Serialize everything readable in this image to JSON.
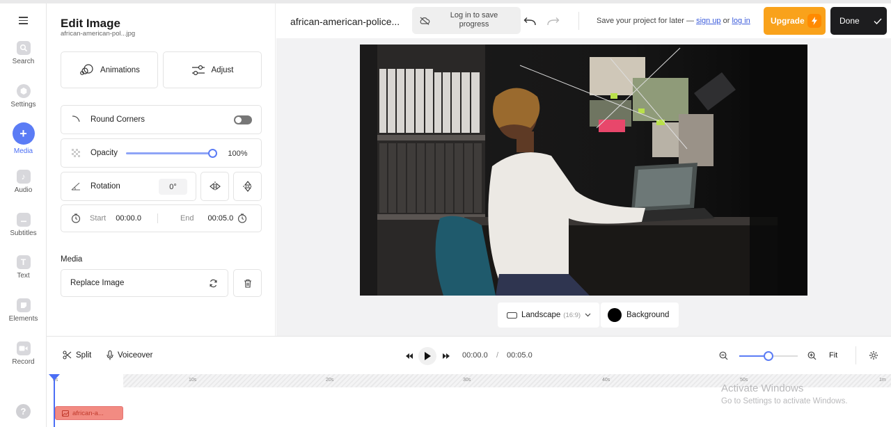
{
  "sidebar": {
    "items": [
      {
        "label": "Search",
        "icon": "search-icon"
      },
      {
        "label": "Settings",
        "icon": "settings-icon"
      },
      {
        "label": "Media",
        "icon": "plus-icon"
      },
      {
        "label": "Audio",
        "icon": "music-icon"
      },
      {
        "label": "Subtitles",
        "icon": "subtitles-icon"
      },
      {
        "label": "Text",
        "icon": "text-icon"
      },
      {
        "label": "Elements",
        "icon": "elements-icon"
      },
      {
        "label": "Record",
        "icon": "record-icon"
      }
    ],
    "active": "Media",
    "help": "?"
  },
  "panel": {
    "title": "Edit Image",
    "filename": "african-american-pol...jpg",
    "animations_label": "Animations",
    "adjust_label": "Adjust",
    "round_corners_label": "Round Corners",
    "opacity_label": "Opacity",
    "opacity_value": "100%",
    "opacity_level": 1.0,
    "rotation_label": "Rotation",
    "rotation_value": "0°",
    "start_label": "Start",
    "start_value": "00:00.0",
    "end_label": "End",
    "end_value": "00:05.0",
    "media_heading": "Media",
    "replace_label": "Replace Image"
  },
  "topbar": {
    "project_title": "african-american-police...",
    "login_save": "Log in to save progress",
    "save_prefix": "Save your project for later —",
    "signup": "sign up",
    "or": "or",
    "login": "log in",
    "upgrade": "Upgrade",
    "done": "Done"
  },
  "canvas": {
    "aspect_label": "Landscape",
    "aspect_ratio": "(16:9)",
    "background_label": "Background"
  },
  "timeline": {
    "split": "Split",
    "voiceover": "Voiceover",
    "current_time": "00:00.0",
    "separator": "/",
    "total_time": "00:05.0",
    "fit": "Fit",
    "zoom_level": 0.5,
    "ruler_ticks": [
      "0s",
      "10s",
      "20s",
      "30s",
      "40s",
      "50s",
      "1m"
    ],
    "clip_label": "african-a..."
  },
  "watermark": {
    "line1": "Activate Windows",
    "line2": "Go to Settings to activate Windows."
  },
  "colors": {
    "accent": "#5b7cf5",
    "upgrade": "#f9a21b",
    "done": "#1d1d1f",
    "clip": "#f28b82"
  }
}
